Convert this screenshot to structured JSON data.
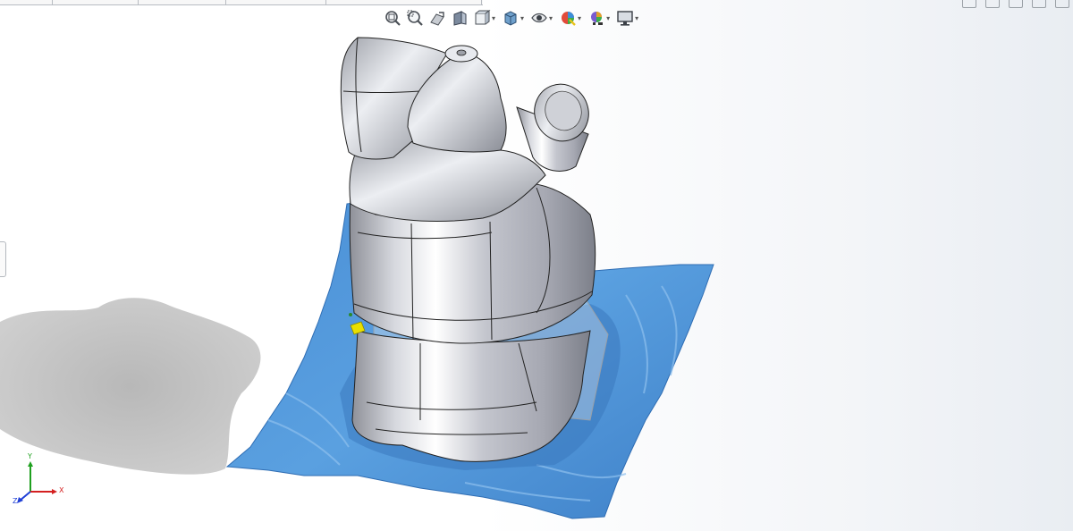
{
  "view_toolbar": {
    "buttons": [
      {
        "name": "zoom-to-fit",
        "icon": "zoom-to-fit-icon"
      },
      {
        "name": "zoom-to-area",
        "icon": "zoom-to-area-icon"
      },
      {
        "name": "previous-view",
        "icon": "previous-view-icon"
      },
      {
        "name": "section-view",
        "icon": "section-view-icon"
      },
      {
        "name": "view-orientation",
        "icon": "view-orientation-icon"
      },
      {
        "name": "display-style",
        "icon": "display-style-icon"
      },
      {
        "name": "hide-show-items",
        "icon": "eye-icon"
      },
      {
        "name": "edit-appearance",
        "icon": "appearance-icon"
      },
      {
        "name": "apply-scene",
        "icon": "scene-icon"
      },
      {
        "name": "view-settings",
        "icon": "monitor-icon"
      }
    ]
  },
  "triad": {
    "x_label": "X",
    "y_label": "Y",
    "z_label": "Z"
  },
  "colors": {
    "part_body": "#c7c9d1",
    "surface_mesh": "#4f94d8",
    "shadow": "#bdbdbd",
    "edge_lines": "#1a1a1a",
    "triad_x": "#d42020",
    "triad_y": "#1fa01f",
    "triad_z": "#1f3fd6"
  }
}
